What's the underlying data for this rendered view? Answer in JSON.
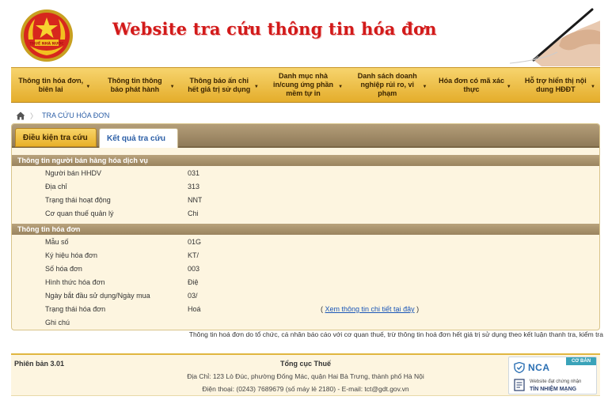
{
  "header": {
    "emblem_text": "THUẾ NHÀ NƯỚC",
    "title": "Website tra cứu thông tin hóa đơn"
  },
  "nav": {
    "items": [
      {
        "label": "Thông tin hóa đơn, biên lai"
      },
      {
        "label": "Thông tin thông báo phát hành"
      },
      {
        "label": "Thông báo ấn chỉ hết giá trị sử dụng"
      },
      {
        "label": "Danh mục nhà in/cung ứng phần mềm tự in"
      },
      {
        "label": "Danh sách doanh nghiệp rủi ro, vi phạm"
      },
      {
        "label": "Hóa đơn có mã xác thực"
      },
      {
        "label": "Hỗ trợ hiển thị nội dung HĐĐT"
      }
    ]
  },
  "breadcrumb": {
    "current": "TRA CỨU HÓA ĐƠN"
  },
  "tabs": {
    "conditions": "Điều kiện tra cứu",
    "results": "Kết quả tra cứu"
  },
  "seller_section": {
    "title": "Thông tin người bán hàng hóa dịch vụ",
    "fields": [
      {
        "label": "Người bán HHDV",
        "value": "031"
      },
      {
        "label": "Địa chỉ",
        "value": "313"
      },
      {
        "label": "Trạng thái hoạt động",
        "value": "NNT"
      },
      {
        "label": "Cơ quan thuế quản lý",
        "value": "Chi"
      }
    ]
  },
  "invoice_section": {
    "title": "Thông tin hóa đơn",
    "fields": [
      {
        "label": "Mẫu số",
        "value": "01G"
      },
      {
        "label": "Ký hiệu hóa đơn",
        "value": "KT/"
      },
      {
        "label": "Số hóa đơn",
        "value": "003"
      },
      {
        "label": "Hình thức hóa đơn",
        "value": "Điệ"
      },
      {
        "label": "Ngày bắt đầu sử dụng/Ngày mua",
        "value": "03/"
      },
      {
        "label": "Trạng thái hóa đơn",
        "value": "Hoá"
      },
      {
        "label": "Ghi chú",
        "value": ""
      }
    ],
    "detail_link": "Xem thông tin chi tiết tại đây",
    "link_open": "(",
    "link_close": ")"
  },
  "disclaimer": "Thông tin hoá đơn do tổ chức, cá nhân báo cáo với cơ quan thuế, trừ thông tin hoá đơn hết giá trị sử dụng theo kết luận thanh tra, kiểm tra",
  "footer": {
    "version": "Phiên bản 3.01",
    "org": "Tổng cục Thuế",
    "address": "Địa Chỉ: 123 Lò Đúc, phường Đống Mác, quận Hai Bà Trưng, thành phố Hà Nội",
    "contact": "Điện thoại: (0243) 7689679 (số máy lẻ 2180) - E-mail: tct@gdt.gov.vn"
  },
  "nca_badge": {
    "ribbon": "CƠ BẢN",
    "name": "NCA",
    "line1": "Website đạt chứng nhận",
    "line2": "TÍN NHIỆM MẠNG"
  },
  "colors": {
    "title_red": "#d21a1a",
    "nav_gold": "#e8b028",
    "tab_bar": "#9a845f",
    "panel_bg": "#fdf5e0",
    "link_blue": "#1a56b8"
  },
  "icons": {
    "home": "home-icon",
    "nav_caret": "caret-down-icon",
    "emblem": "tax-emblem-icon",
    "pen": "pen-hand-icon",
    "nca_shield": "shield-icon",
    "nca_doc": "certificate-icon"
  }
}
